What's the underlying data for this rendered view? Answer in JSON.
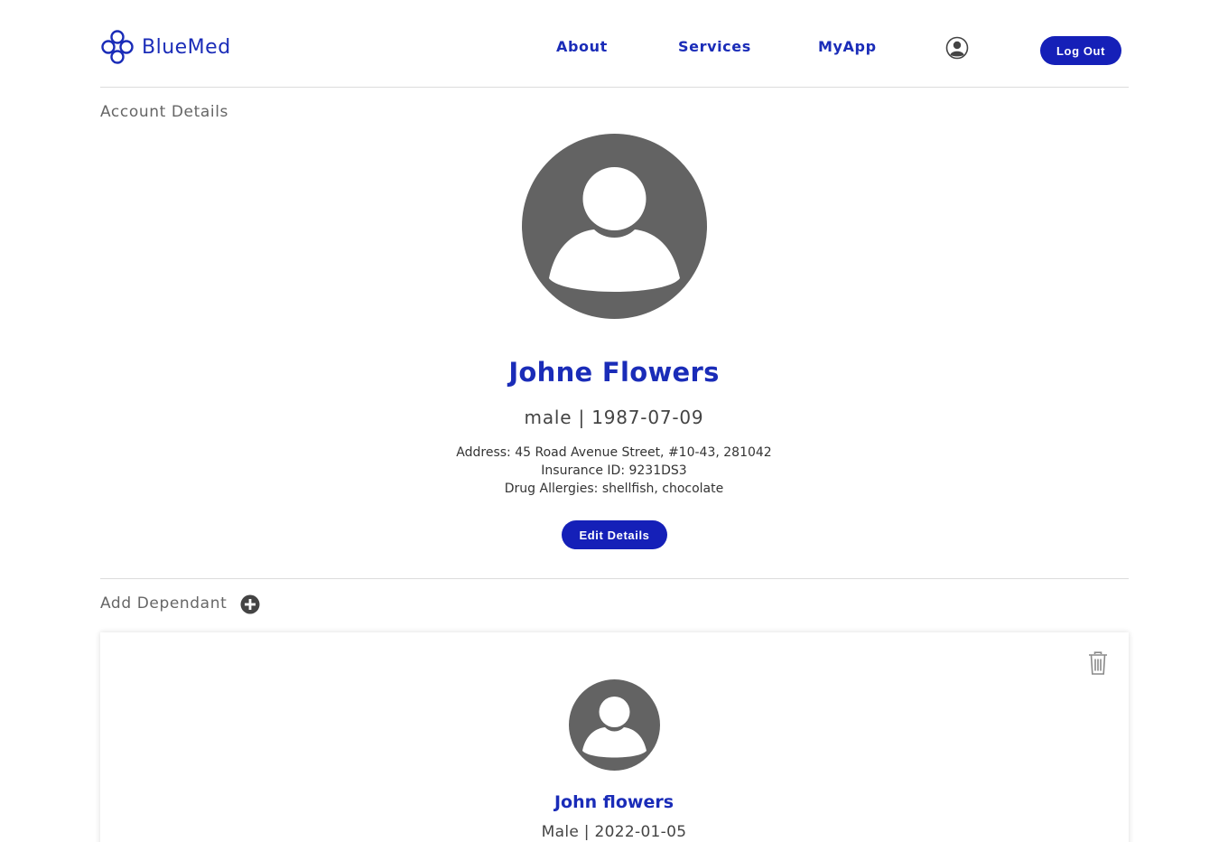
{
  "brand": {
    "name": "BlueMed",
    "color": "#1a2cb8"
  },
  "nav": {
    "items": [
      {
        "label": "About"
      },
      {
        "label": "Services"
      },
      {
        "label": "MyApp"
      }
    ],
    "profile_icon": "user-circle-icon",
    "logout_label": "Log Out"
  },
  "account": {
    "section_title": "Account Details",
    "avatar_icon": "user-avatar-icon",
    "name": "Johne Flowers",
    "meta": "male | 1987-07-09",
    "address": "Address: 45 Road Avenue Street, #10-43, 281042",
    "insurance": "Insurance ID: 9231DS3",
    "allergies": "Drug Allergies: shellfish, chocolate",
    "edit_label": "Edit Details"
  },
  "dependants": {
    "section_title": "Add Dependant",
    "add_icon": "plus-circle-icon",
    "items": [
      {
        "name": "John flowers",
        "meta": "Male | 2022-01-05",
        "avatar_icon": "user-avatar-icon",
        "delete_icon": "trash-icon"
      }
    ]
  },
  "colors": {
    "primary": "#1520b8",
    "avatar": "#636363",
    "muted_text": "#666666",
    "divider": "#dcdcdc"
  }
}
